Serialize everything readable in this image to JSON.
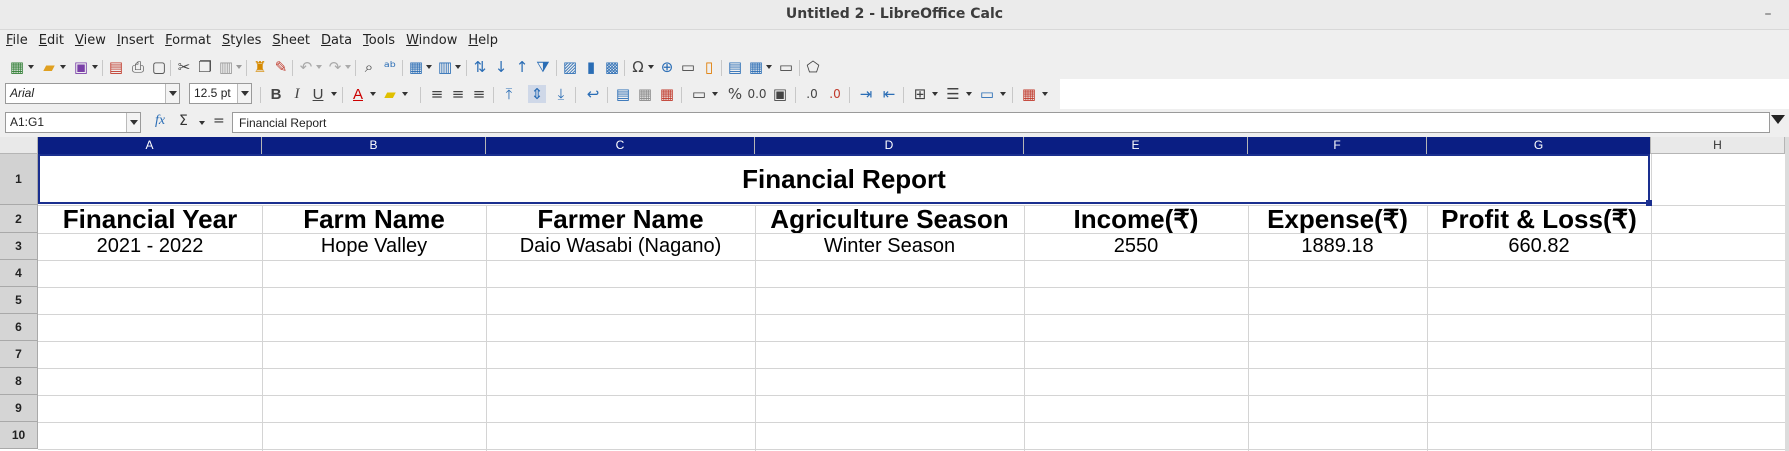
{
  "window": {
    "title": "Untitled 2 - LibreOffice Calc",
    "minimize_glyph": "–"
  },
  "menu": [
    "File",
    "Edit",
    "View",
    "Insert",
    "Format",
    "Styles",
    "Sheet",
    "Data",
    "Tools",
    "Window",
    "Help"
  ],
  "formatting": {
    "font_name": "Arial",
    "font_size": "12.5 pt"
  },
  "formula_bar": {
    "name_box": "A1:G1",
    "fx_glyph": "fx",
    "sum_glyph": "Σ",
    "eq_glyph": "=",
    "content": "Financial Report"
  },
  "columns": [
    "A",
    "B",
    "C",
    "D",
    "E",
    "F",
    "G",
    "H"
  ],
  "rows": [
    "1",
    "2",
    "3",
    "4",
    "5",
    "6",
    "7",
    "8",
    "9",
    "10"
  ],
  "sheet": {
    "title": "Financial Report",
    "headers": [
      "Financial Year",
      "Farm Name",
      "Farmer Name",
      "Agriculture Season",
      "Income(₹)",
      "Expense(₹)",
      "Profit & Loss(₹)"
    ],
    "row3": [
      "2021 - 2022",
      "Hope Valley",
      "Daio Wasabi (Nagano)",
      "Winter Season",
      "2550",
      "1889.18",
      "660.82"
    ]
  },
  "colors": {
    "selection_header": "#0a1e83",
    "selection_border": "#1a2f8f"
  }
}
